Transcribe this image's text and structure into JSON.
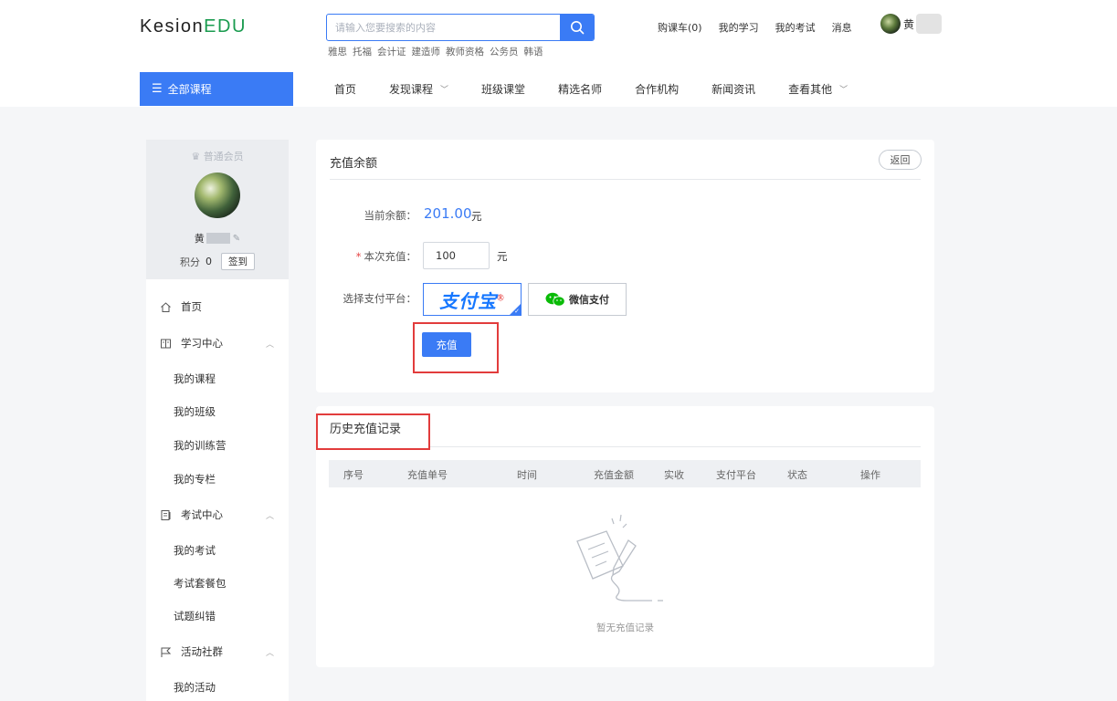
{
  "header": {
    "logo_main": "Kesion",
    "logo_accent": "EDU",
    "search_placeholder": "请输入您要搜索的内容",
    "hot_tags": [
      "雅思",
      "托福",
      "会计证",
      "建造师",
      "教师资格",
      "公务员",
      "韩语"
    ],
    "top_links": [
      "购课车(0)",
      "我的学习",
      "我的考试",
      "消息"
    ],
    "user_name_initial": "黄"
  },
  "nav": {
    "all_courses": "全部课程",
    "items": [
      {
        "label": "首页",
        "has_caret": false
      },
      {
        "label": "发现课程",
        "has_caret": true
      },
      {
        "label": "班级课堂",
        "has_caret": false
      },
      {
        "label": "精选名师",
        "has_caret": false
      },
      {
        "label": "合作机构",
        "has_caret": false
      },
      {
        "label": "新闻资讯",
        "has_caret": false
      },
      {
        "label": "查看其他",
        "has_caret": true
      }
    ]
  },
  "profile": {
    "member_level": "普通会员",
    "name_initial": "黄",
    "points_label": "积分",
    "points_value": "0",
    "sign_in": "签到"
  },
  "sidebar": {
    "home": "首页",
    "study_center": "学习中心",
    "study_items": [
      "我的课程",
      "我的班级",
      "我的训练营",
      "我的专栏"
    ],
    "exam_center": "考试中心",
    "exam_items": [
      "我的考试",
      "考试套餐包",
      "试题纠错"
    ],
    "community": "活动社群",
    "community_items": [
      "我的活动"
    ]
  },
  "recharge": {
    "title": "充值余额",
    "back": "返回",
    "balance_label": "当前余额：",
    "balance_value": "201.00",
    "unit": "元",
    "amount_label": "本次充值：",
    "amount_value": "100",
    "platform_label": "选择支付平台：",
    "alipay": "支付宝",
    "wechat": "微信支付",
    "submit": "充值"
  },
  "history": {
    "title": "历史充值记录",
    "columns": [
      "序号",
      "充值单号",
      "时间",
      "充值金额",
      "实收",
      "支付平台",
      "状态",
      "操作"
    ],
    "rows": [],
    "empty_text": "暂无充值记录"
  },
  "colors": {
    "primary": "#3a7bf5",
    "logo_green": "#1a9b4f",
    "highlight_red": "#e23c3c",
    "alipay_blue": "#1677ff",
    "wechat_green": "#09bb07"
  }
}
